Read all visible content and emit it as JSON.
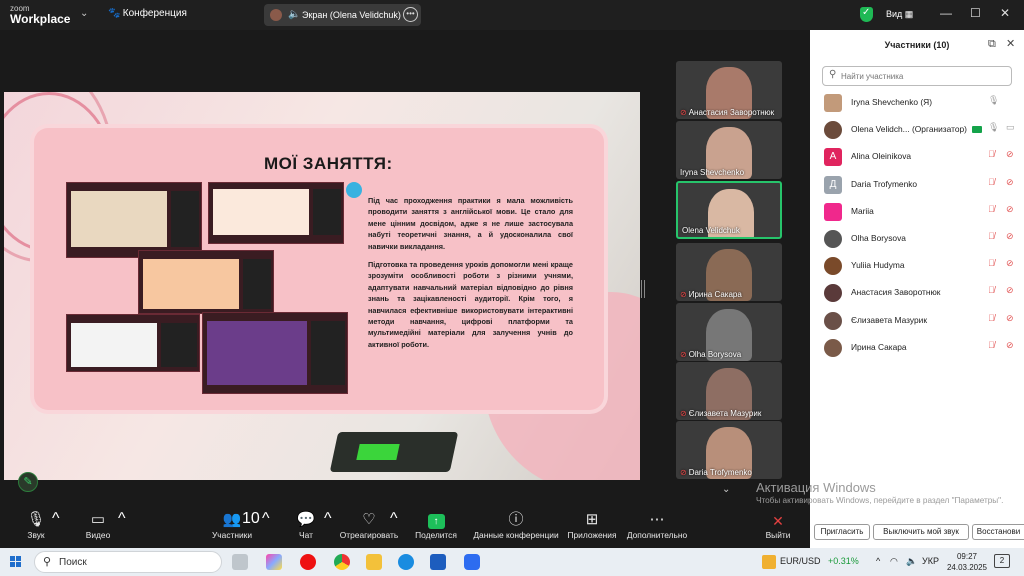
{
  "topbar": {
    "logo_line1": "zoom",
    "logo_line2": "Workplace",
    "meeting_label": "Конференция",
    "share_label": "Экран (Olena Velidchuk)",
    "more_label": "•••",
    "view_label": "Вид",
    "minimize": "—",
    "maximize": "☐",
    "close": "✕"
  },
  "slide": {
    "title": "МОЇ ЗАНЯТТЯ:",
    "paragraph1": "Під час проходження практики я мала можливість проводити заняття з англійської мови. Це стало для мене цінним досвідом, адже я не лише застосувала набуті теоретичні знання, а й удосконалила свої навички викладання.",
    "paragraph2": "Підготовка та проведення уроків допомогли мені краще зрозуміти особливості роботи з різними учнями, адаптувати навчальний матеріал відповідно до рівня знань та зацікавленості аудиторії. Крім того, я навчилася ефективніше використовувати інтерактивні методи навчання, цифрові платформи та мультимедійні матеріали для залучення учнів до активної роботи."
  },
  "video_tiles": [
    {
      "name": "Анастасия Заворотнюк",
      "muted": true,
      "skin": "#a97a6a"
    },
    {
      "name": "Iryna Shevchenko",
      "muted": false,
      "skin": "#c9a28f"
    },
    {
      "name": "Olena Velidchuk",
      "muted": false,
      "skin": "#d9b8a3",
      "active": true
    },
    {
      "name": "Ирина Сакара",
      "muted": true,
      "skin": "#8a6a55"
    },
    {
      "name": "Olha Borysova",
      "muted": true,
      "skin": "#777777"
    },
    {
      "name": "Єлизавета Мазурик",
      "muted": true,
      "skin": "#8e6e63"
    },
    {
      "name": "Daria Trofymenko",
      "muted": true,
      "skin": "#b88f7a"
    }
  ],
  "participants": {
    "title": "Участники (10)",
    "search_placeholder": "Найти участника",
    "list": [
      {
        "name": "Iryna Shevchenko (Я)",
        "avatar_letter": "",
        "avatar_color": "#c29a7a",
        "mic_muted": false,
        "cam_off": false,
        "cam_icon": ""
      },
      {
        "name": "Olena Velidch... (Организатор)",
        "avatar_letter": "",
        "avatar_color": "#6b4b3b",
        "mic_muted": false,
        "cam_off": false,
        "cam_icon": "▭",
        "host": true
      },
      {
        "name": "Alina Oleinikova",
        "avatar_letter": "A",
        "avatar_color": "#e0245e",
        "mic_muted": true,
        "cam_off": true,
        "cam_icon": "⊘"
      },
      {
        "name": "Daria Trofymenko",
        "avatar_letter": "Д",
        "avatar_color": "#9aa3ad",
        "mic_muted": true,
        "cam_off": true,
        "cam_icon": "⊘"
      },
      {
        "name": "Mariia",
        "avatar_letter": "",
        "avatar_color": "#f0288c",
        "mic_muted": true,
        "cam_off": true,
        "cam_icon": "⊘"
      },
      {
        "name": "Olha Borysova",
        "avatar_letter": "",
        "avatar_color": "#555555",
        "mic_muted": true,
        "cam_off": true,
        "cam_icon": "⊘"
      },
      {
        "name": "Yuliia Hudyma",
        "avatar_letter": "",
        "avatar_color": "#7a4a2a",
        "mic_muted": true,
        "cam_off": true,
        "cam_icon": "⊘"
      },
      {
        "name": "Анастасия Заворотнюк",
        "avatar_letter": "",
        "avatar_color": "#5a3a3a",
        "mic_muted": true,
        "cam_off": true,
        "cam_icon": "⊘"
      },
      {
        "name": "Єлизавета Мазурик",
        "avatar_letter": "",
        "avatar_color": "#6a5048",
        "mic_muted": true,
        "cam_off": true,
        "cam_icon": "⊘"
      },
      {
        "name": "Ирина Сакара",
        "avatar_letter": "",
        "avatar_color": "#7a5a48",
        "mic_muted": true,
        "cam_off": true,
        "cam_icon": "⊘"
      }
    ],
    "buttons": {
      "invite": "Пригласить",
      "mute_me": "Выключить мой звук",
      "restore": "Восстанови"
    }
  },
  "activation": {
    "title": "Активация Windows",
    "text": "Чтобы активировать Windows, перейдите в раздел \"Параметры\"."
  },
  "toolbar": {
    "audio": "Звук",
    "video": "Видео",
    "participants": "Участники",
    "participants_count": "10",
    "chat": "Чат",
    "react": "Отреагировать",
    "share": "Поделится",
    "info": "Данные конференции",
    "apps": "Приложения",
    "more": "Дополнительно",
    "leave": "Выйти"
  },
  "taskbar": {
    "search": "Поиск",
    "ticker": "EUR/USD",
    "ticker_change": "+0.31%",
    "lang": "УКР",
    "time": "09:27",
    "date": "24.03.2025",
    "notif_count": "2"
  }
}
